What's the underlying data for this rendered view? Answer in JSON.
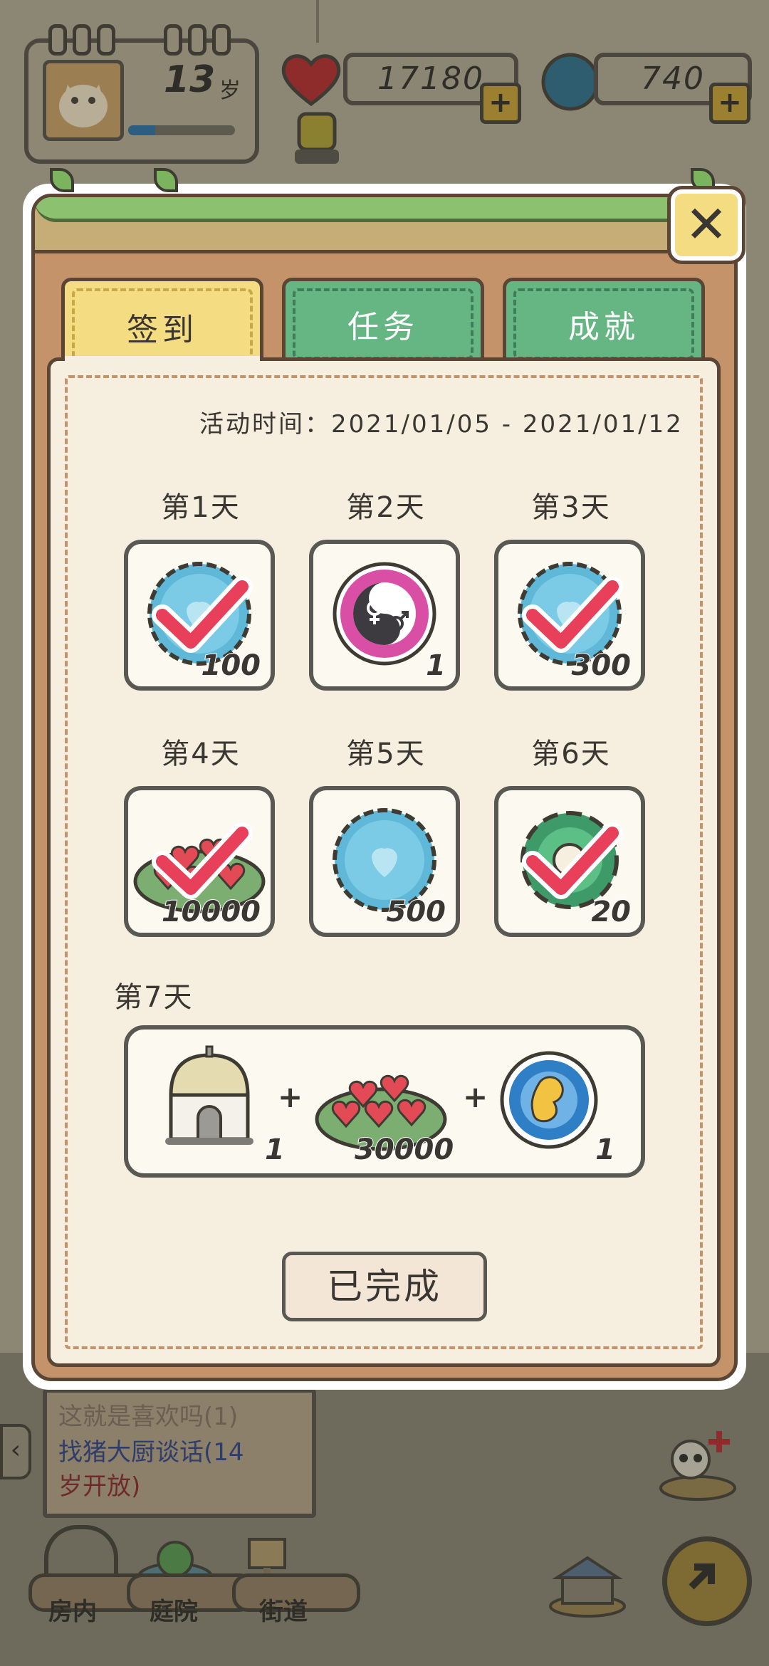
{
  "header": {
    "age_value": "13",
    "age_unit": "岁",
    "age_progress": 0.25,
    "hearts_count": "17180",
    "bottlecaps_count": "740",
    "add_label": "+"
  },
  "dialog": {
    "close_label": "✕",
    "tabs": [
      {
        "label": "签到",
        "active": true
      },
      {
        "label": "任务",
        "active": false
      },
      {
        "label": "成就",
        "active": false
      }
    ],
    "activity_time": "活动时间：2021/01/05 - 2021/01/12",
    "days": [
      {
        "label": "第1天",
        "item": "blue-bottlecap-icon",
        "qty": "100",
        "claimed": true
      },
      {
        "label": "第2天",
        "item": "gender-yinyang-icon",
        "qty": "1",
        "claimed": false
      },
      {
        "label": "第3天",
        "item": "blue-bottlecap-icon",
        "qty": "300",
        "claimed": true
      },
      {
        "label": "第4天",
        "item": "hearts-plate-icon",
        "qty": "10000",
        "claimed": true
      },
      {
        "label": "第5天",
        "item": "blue-bottlecap-icon",
        "qty": "500",
        "claimed": false
      },
      {
        "label": "第6天",
        "item": "green-gear-icon",
        "qty": "20",
        "claimed": true
      }
    ],
    "day7": {
      "label": "第7天",
      "items": [
        {
          "item": "dome-house-icon",
          "qty": "1"
        },
        {
          "item": "hearts-plate-icon",
          "qty": "30000"
        },
        {
          "item": "baby-embryo-icon",
          "qty": "1"
        }
      ],
      "plus": "+"
    },
    "done_label": "已完成"
  },
  "background": {
    "task_line1": "这就是喜欢吗(1)",
    "task_line2": "找猪大厨谈话(14",
    "task_line3": "岁开放)",
    "nav": [
      "房内",
      "庭院",
      "街道"
    ]
  },
  "colors": {
    "tab_active": "#f3dc82",
    "tab_inactive": "#66b684",
    "panel_brown": "#c4936a",
    "paper": "#f6efe0",
    "check_red": "#e8405a"
  }
}
